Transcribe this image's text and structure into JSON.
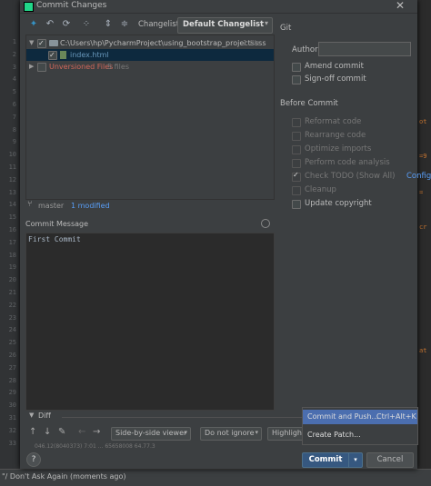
{
  "dialog": {
    "title": "Commit Changes"
  },
  "background": {
    "gutter_lines": [
      "1",
      "2",
      "3",
      "4",
      "5",
      "6",
      "7",
      "8",
      "9",
      "10",
      "11",
      "12",
      "13",
      "14",
      "15",
      "16",
      "17",
      "18",
      "19",
      "20",
      "21",
      "22",
      "23",
      "24",
      "25",
      "26",
      "27",
      "28",
      "29",
      "30",
      "31",
      "32",
      "33"
    ],
    "status_text": "\"/ Don't Ask Again (moments ago)"
  },
  "toolbar": {
    "changelist_label": "Changelist:",
    "changelist_value": "Default Changelist"
  },
  "tree": {
    "root_path": "C:\\Users\\hp\\PycharmProject\\using_bootstrap_projectssss",
    "root_count": "1 file",
    "file_name": "index.html",
    "unversioned_label": "Unversioned Files",
    "unversioned_count": "5 files"
  },
  "branch": {
    "name": "master",
    "modified": "1 modified"
  },
  "commit_message": {
    "label": "Commit Message",
    "text": "First Commit"
  },
  "git": {
    "section_label": "Git",
    "author_label": "Author:",
    "author_value": "",
    "amend_label": "Amend commit",
    "signoff_label": "Sign-off commit"
  },
  "before_commit": {
    "section_label": "Before Commit",
    "reformat": "Reformat code",
    "rearrange": "Rearrange code",
    "optimize": "Optimize imports",
    "analysis": "Perform code analysis",
    "todo": "Check TODO (Show All)",
    "configure": "Configure",
    "cleanup": "Cleanup",
    "copyright": "Update copyright"
  },
  "diff": {
    "label": "Diff",
    "viewer": "Side-by-side viewer",
    "ignore": "Do not ignore",
    "highlight": "Highlight",
    "info": "046.12(8040373) 7:01 ... 65658008 64.77.3"
  },
  "buttons": {
    "help": "?",
    "commit": "Commit",
    "cancel": "Cancel"
  },
  "popup": {
    "commit_push": "Commit and Push...",
    "commit_push_shortcut": "Ctrl+Alt+K",
    "create_patch": "Create Patch..."
  }
}
